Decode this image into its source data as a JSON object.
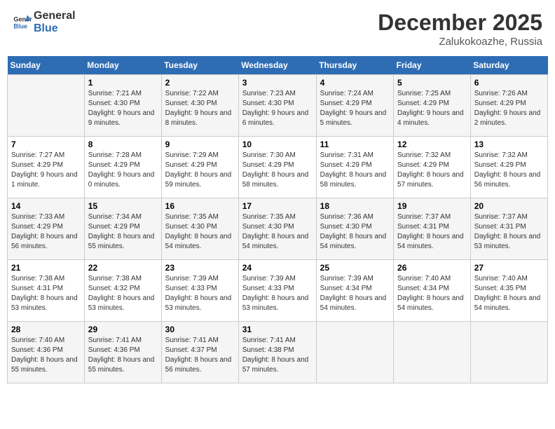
{
  "header": {
    "logo_line1": "General",
    "logo_line2": "Blue",
    "month": "December 2025",
    "location": "Zalukokoazhe, Russia"
  },
  "days_of_week": [
    "Sunday",
    "Monday",
    "Tuesday",
    "Wednesday",
    "Thursday",
    "Friday",
    "Saturday"
  ],
  "weeks": [
    [
      {
        "num": "",
        "sunrise": "",
        "sunset": "",
        "daylight": ""
      },
      {
        "num": "1",
        "sunrise": "Sunrise: 7:21 AM",
        "sunset": "Sunset: 4:30 PM",
        "daylight": "Daylight: 9 hours and 9 minutes."
      },
      {
        "num": "2",
        "sunrise": "Sunrise: 7:22 AM",
        "sunset": "Sunset: 4:30 PM",
        "daylight": "Daylight: 9 hours and 8 minutes."
      },
      {
        "num": "3",
        "sunrise": "Sunrise: 7:23 AM",
        "sunset": "Sunset: 4:30 PM",
        "daylight": "Daylight: 9 hours and 6 minutes."
      },
      {
        "num": "4",
        "sunrise": "Sunrise: 7:24 AM",
        "sunset": "Sunset: 4:29 PM",
        "daylight": "Daylight: 9 hours and 5 minutes."
      },
      {
        "num": "5",
        "sunrise": "Sunrise: 7:25 AM",
        "sunset": "Sunset: 4:29 PM",
        "daylight": "Daylight: 9 hours and 4 minutes."
      },
      {
        "num": "6",
        "sunrise": "Sunrise: 7:26 AM",
        "sunset": "Sunset: 4:29 PM",
        "daylight": "Daylight: 9 hours and 2 minutes."
      }
    ],
    [
      {
        "num": "7",
        "sunrise": "Sunrise: 7:27 AM",
        "sunset": "Sunset: 4:29 PM",
        "daylight": "Daylight: 9 hours and 1 minute."
      },
      {
        "num": "8",
        "sunrise": "Sunrise: 7:28 AM",
        "sunset": "Sunset: 4:29 PM",
        "daylight": "Daylight: 9 hours and 0 minutes."
      },
      {
        "num": "9",
        "sunrise": "Sunrise: 7:29 AM",
        "sunset": "Sunset: 4:29 PM",
        "daylight": "Daylight: 8 hours and 59 minutes."
      },
      {
        "num": "10",
        "sunrise": "Sunrise: 7:30 AM",
        "sunset": "Sunset: 4:29 PM",
        "daylight": "Daylight: 8 hours and 58 minutes."
      },
      {
        "num": "11",
        "sunrise": "Sunrise: 7:31 AM",
        "sunset": "Sunset: 4:29 PM",
        "daylight": "Daylight: 8 hours and 58 minutes."
      },
      {
        "num": "12",
        "sunrise": "Sunrise: 7:32 AM",
        "sunset": "Sunset: 4:29 PM",
        "daylight": "Daylight: 8 hours and 57 minutes."
      },
      {
        "num": "13",
        "sunrise": "Sunrise: 7:32 AM",
        "sunset": "Sunset: 4:29 PM",
        "daylight": "Daylight: 8 hours and 56 minutes."
      }
    ],
    [
      {
        "num": "14",
        "sunrise": "Sunrise: 7:33 AM",
        "sunset": "Sunset: 4:29 PM",
        "daylight": "Daylight: 8 hours and 56 minutes."
      },
      {
        "num": "15",
        "sunrise": "Sunrise: 7:34 AM",
        "sunset": "Sunset: 4:29 PM",
        "daylight": "Daylight: 8 hours and 55 minutes."
      },
      {
        "num": "16",
        "sunrise": "Sunrise: 7:35 AM",
        "sunset": "Sunset: 4:30 PM",
        "daylight": "Daylight: 8 hours and 54 minutes."
      },
      {
        "num": "17",
        "sunrise": "Sunrise: 7:35 AM",
        "sunset": "Sunset: 4:30 PM",
        "daylight": "Daylight: 8 hours and 54 minutes."
      },
      {
        "num": "18",
        "sunrise": "Sunrise: 7:36 AM",
        "sunset": "Sunset: 4:30 PM",
        "daylight": "Daylight: 8 hours and 54 minutes."
      },
      {
        "num": "19",
        "sunrise": "Sunrise: 7:37 AM",
        "sunset": "Sunset: 4:31 PM",
        "daylight": "Daylight: 8 hours and 54 minutes."
      },
      {
        "num": "20",
        "sunrise": "Sunrise: 7:37 AM",
        "sunset": "Sunset: 4:31 PM",
        "daylight": "Daylight: 8 hours and 53 minutes."
      }
    ],
    [
      {
        "num": "21",
        "sunrise": "Sunrise: 7:38 AM",
        "sunset": "Sunset: 4:31 PM",
        "daylight": "Daylight: 8 hours and 53 minutes."
      },
      {
        "num": "22",
        "sunrise": "Sunrise: 7:38 AM",
        "sunset": "Sunset: 4:32 PM",
        "daylight": "Daylight: 8 hours and 53 minutes."
      },
      {
        "num": "23",
        "sunrise": "Sunrise: 7:39 AM",
        "sunset": "Sunset: 4:33 PM",
        "daylight": "Daylight: 8 hours and 53 minutes."
      },
      {
        "num": "24",
        "sunrise": "Sunrise: 7:39 AM",
        "sunset": "Sunset: 4:33 PM",
        "daylight": "Daylight: 8 hours and 53 minutes."
      },
      {
        "num": "25",
        "sunrise": "Sunrise: 7:39 AM",
        "sunset": "Sunset: 4:34 PM",
        "daylight": "Daylight: 8 hours and 54 minutes."
      },
      {
        "num": "26",
        "sunrise": "Sunrise: 7:40 AM",
        "sunset": "Sunset: 4:34 PM",
        "daylight": "Daylight: 8 hours and 54 minutes."
      },
      {
        "num": "27",
        "sunrise": "Sunrise: 7:40 AM",
        "sunset": "Sunset: 4:35 PM",
        "daylight": "Daylight: 8 hours and 54 minutes."
      }
    ],
    [
      {
        "num": "28",
        "sunrise": "Sunrise: 7:40 AM",
        "sunset": "Sunset: 4:36 PM",
        "daylight": "Daylight: 8 hours and 55 minutes."
      },
      {
        "num": "29",
        "sunrise": "Sunrise: 7:41 AM",
        "sunset": "Sunset: 4:36 PM",
        "daylight": "Daylight: 8 hours and 55 minutes."
      },
      {
        "num": "30",
        "sunrise": "Sunrise: 7:41 AM",
        "sunset": "Sunset: 4:37 PM",
        "daylight": "Daylight: 8 hours and 56 minutes."
      },
      {
        "num": "31",
        "sunrise": "Sunrise: 7:41 AM",
        "sunset": "Sunset: 4:38 PM",
        "daylight": "Daylight: 8 hours and 57 minutes."
      },
      {
        "num": "",
        "sunrise": "",
        "sunset": "",
        "daylight": ""
      },
      {
        "num": "",
        "sunrise": "",
        "sunset": "",
        "daylight": ""
      },
      {
        "num": "",
        "sunrise": "",
        "sunset": "",
        "daylight": ""
      }
    ]
  ]
}
